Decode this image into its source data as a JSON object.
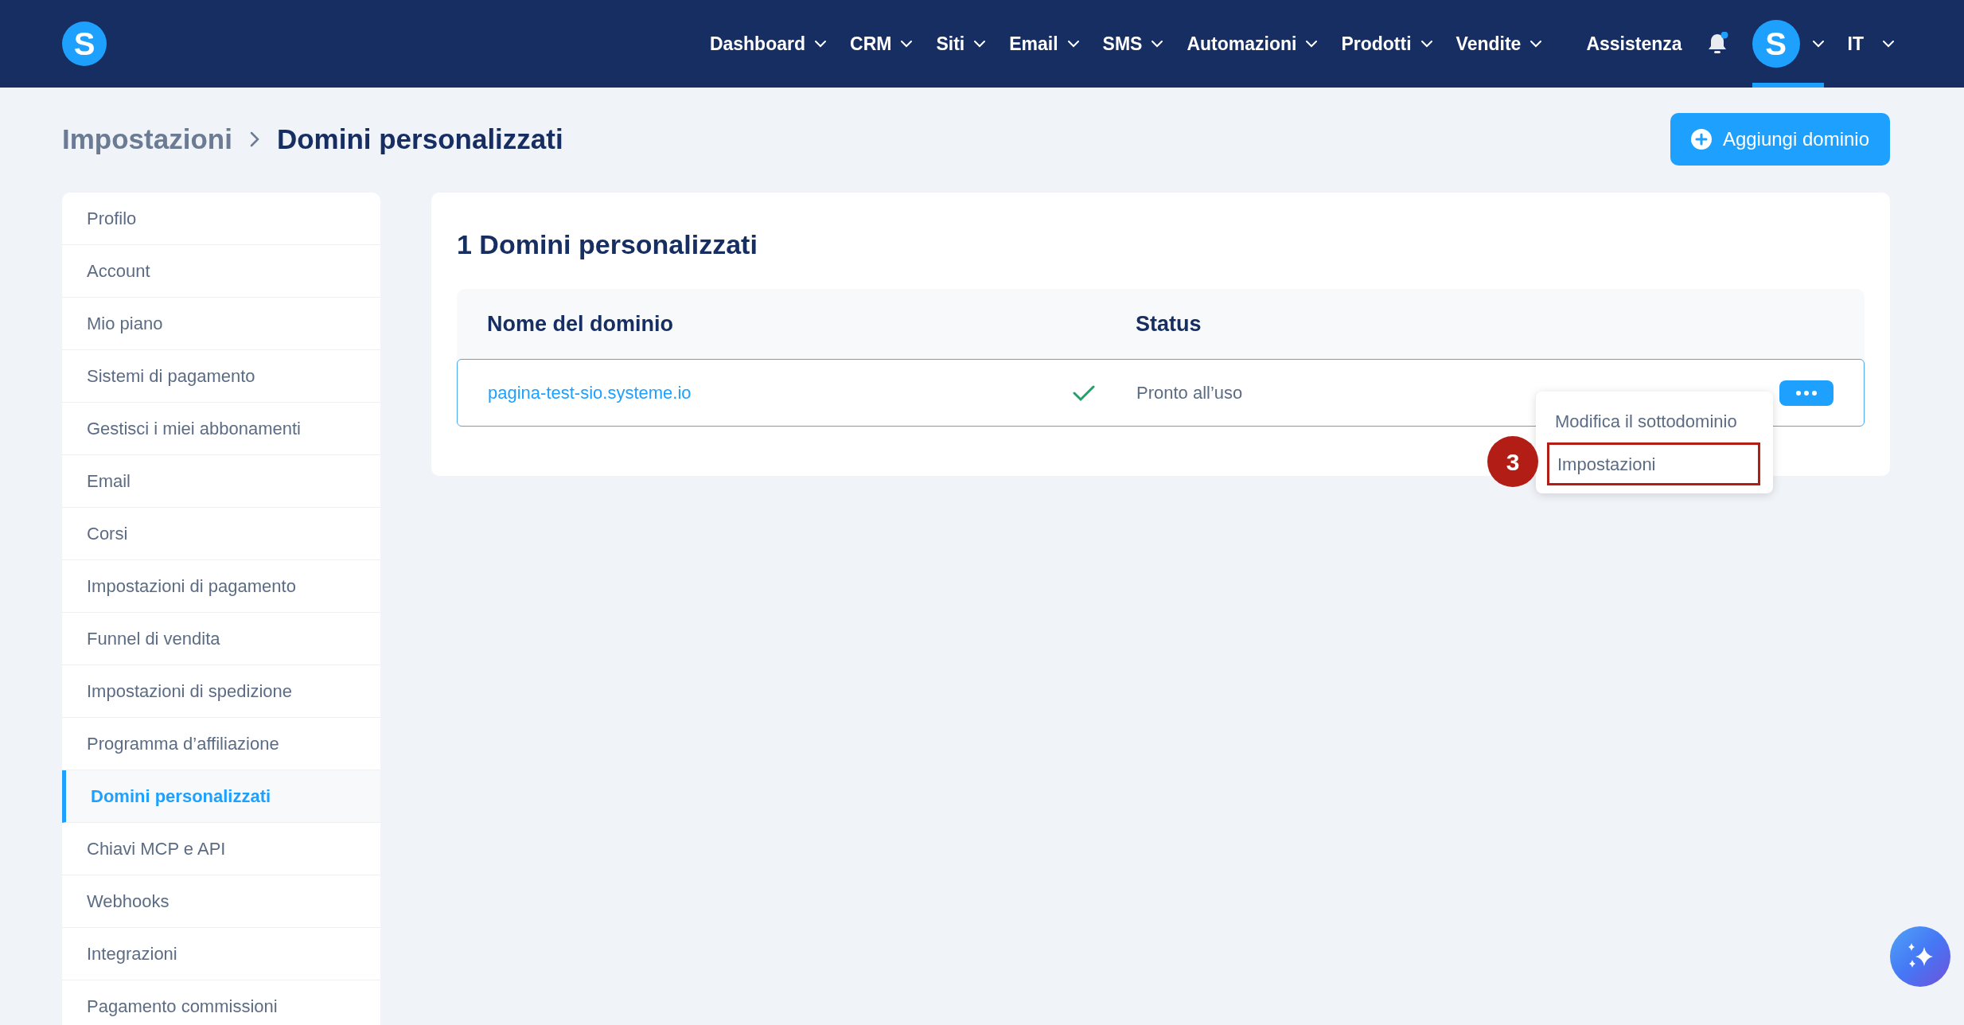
{
  "top_nav": {
    "logo": "S",
    "items": [
      {
        "label": "Dashboard",
        "dropdown": true
      },
      {
        "label": "CRM",
        "dropdown": true
      },
      {
        "label": "Siti",
        "dropdown": true
      },
      {
        "label": "Email",
        "dropdown": true
      },
      {
        "label": "SMS",
        "dropdown": true
      },
      {
        "label": "Automazioni",
        "dropdown": true
      },
      {
        "label": "Prodotti",
        "dropdown": true
      },
      {
        "label": "Vendite",
        "dropdown": true
      },
      {
        "label": "Assistenza",
        "dropdown": false
      }
    ],
    "notifications": {
      "unread": true
    },
    "avatar": {
      "letter": "S",
      "selected": true
    },
    "language": "IT"
  },
  "breadcrumb": [
    "Impostazioni",
    "Domini personalizzati"
  ],
  "add_button": "Aggiungi dominio",
  "sidebar": {
    "items": [
      {
        "label": "Profilo",
        "selected": false
      },
      {
        "label": "Account",
        "selected": false
      },
      {
        "label": "Mio piano",
        "selected": false
      },
      {
        "label": "Sistemi di pagamento",
        "selected": false
      },
      {
        "label": "Gestisci i miei abbonamenti",
        "selected": false
      },
      {
        "label": "Email",
        "selected": false
      },
      {
        "label": "Corsi",
        "selected": false
      },
      {
        "label": "Impostazioni di pagamento",
        "selected": false
      },
      {
        "label": "Funnel di vendita",
        "selected": false
      },
      {
        "label": "Impostazioni di spedizione",
        "selected": false
      },
      {
        "label": "Programma d’affiliazione",
        "selected": false
      },
      {
        "label": "Domini personalizzati",
        "selected": true
      },
      {
        "label": "Chiavi MCP e API",
        "selected": false
      },
      {
        "label": "Webhooks",
        "selected": false
      },
      {
        "label": "Integrazioni",
        "selected": false
      },
      {
        "label": "Pagamento commissioni",
        "selected": false
      }
    ]
  },
  "panel": {
    "title": "1 Domini personalizzati",
    "table": {
      "columns": [
        "Nome del dominio",
        "Status"
      ],
      "rows": [
        {
          "domain": "pagina-test-sio.systeme.io",
          "verified": true,
          "status": "Pronto all’uso"
        }
      ]
    },
    "menu": {
      "items": [
        {
          "label": "Modifica il sottodominio",
          "highlighted": false
        },
        {
          "label": "Impostazioni",
          "highlighted": true
        }
      ]
    },
    "annotation": {
      "number": "3"
    }
  }
}
